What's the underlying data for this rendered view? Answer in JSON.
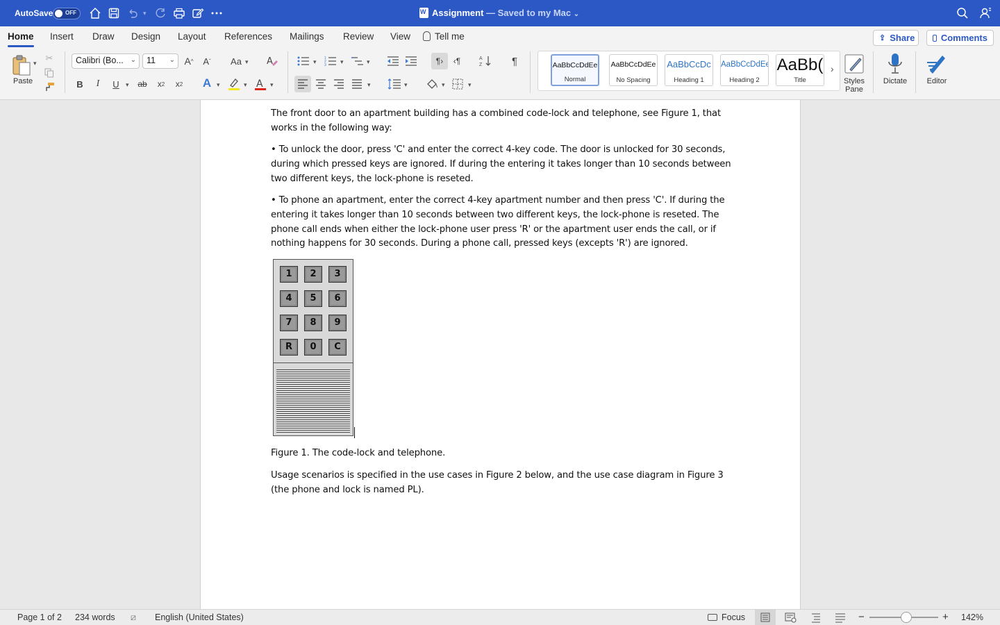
{
  "titlebar": {
    "autosave_label": "AutoSave",
    "autosave_state": "OFF",
    "doc_name": "Assignment",
    "doc_status": " — Saved to my Mac",
    "accent": "#2b58c4"
  },
  "ribbon": {
    "tabs": [
      "Home",
      "Insert",
      "Draw",
      "Design",
      "Layout",
      "References",
      "Mailings",
      "Review",
      "View"
    ],
    "tell_me": "Tell me",
    "share": "Share",
    "comments": "Comments",
    "paste": "Paste",
    "font_name": "Calibri (Bo...",
    "font_size": "11",
    "styles": [
      {
        "sample": "AaBbCcDdEe",
        "name": "Normal"
      },
      {
        "sample": "AaBbCcDdEe",
        "name": "No Spacing"
      },
      {
        "sample": "AaBbCcDc",
        "name": "Heading 1"
      },
      {
        "sample": "AaBbCcDdEe",
        "name": "Heading 2"
      },
      {
        "sample": "AaBb(",
        "name": "Title"
      }
    ],
    "styles_pane": "Styles Pane",
    "dictate": "Dictate",
    "editor": "Editor"
  },
  "document": {
    "intro": "The front door to an apartment building has a combined code-lock and telephone, see Figure 1, that works in the following way:",
    "bullet1": "•  To unlock the door, press 'C' and enter the correct 4-key code. The door is unlocked for 30 seconds, during which pressed keys are ignored. If during the entering it takes longer than 10 seconds between two different keys, the lock-phone is reseted.",
    "bullet2": "•  To phone an apartment, enter the correct 4-key apartment number and then press 'C'. If during the entering it takes longer than 10 seconds between two different keys, the lock-phone is reseted. The phone call ends when either the lock-phone user press 'R' or the apartment user ends the call, or if nothing happens for 30 seconds. During a phone call, pressed keys (excepts 'R') are ignored.",
    "keys": [
      "1",
      "2",
      "3",
      "4",
      "5",
      "6",
      "7",
      "8",
      "9",
      "R",
      "0",
      "C"
    ],
    "caption": "Figure 1. The code-lock and telephone.",
    "usage": "Usage scenarios is specified in the use cases in Figure 2 below, and the use case diagram in Figure 3 (the phone and lock is named PL)."
  },
  "statusbar": {
    "page": "Page 1 of 2",
    "words": "234 words",
    "language": "English (United States)",
    "focus": "Focus",
    "zoom": "142%"
  }
}
